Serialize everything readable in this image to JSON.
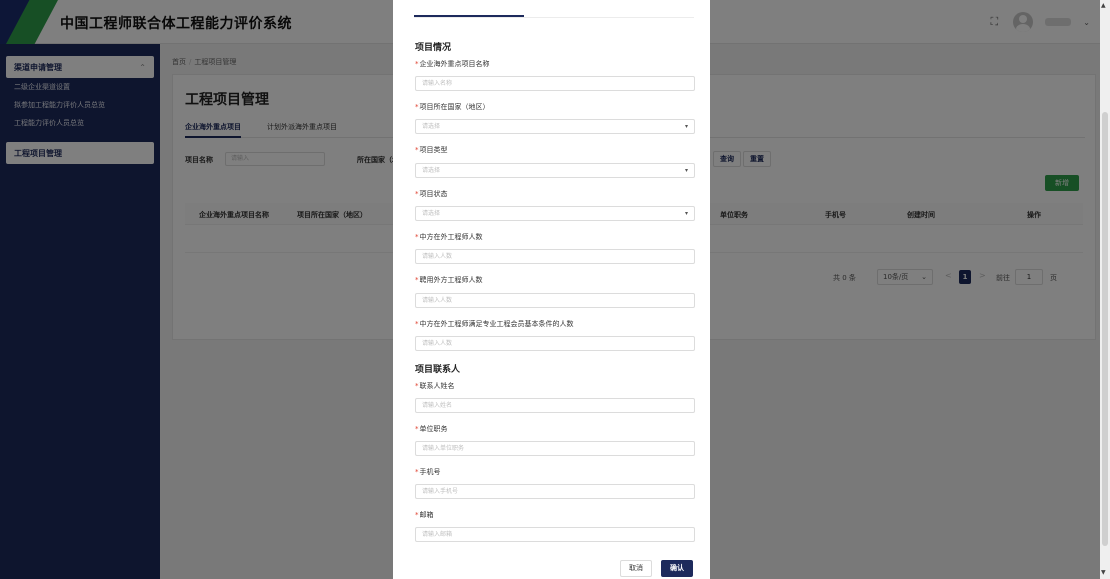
{
  "app": {
    "title": "中国工程师联合体工程能力评价系统"
  },
  "topbar": {
    "fullscreen_icon": "fullscreen-icon",
    "avatar_icon": "user-avatar-icon"
  },
  "sidebar": {
    "group1": {
      "label": "渠道申请管理",
      "chevron": "⌃"
    },
    "group1_items": [
      {
        "label": "二级企业渠道设置"
      },
      {
        "label": "拟参加工程能力评价人员总览"
      },
      {
        "label": "工程能力评价人员总览"
      }
    ],
    "group2": {
      "label": "工程项目管理"
    }
  },
  "main": {
    "breadcrumb": {
      "home": "首页",
      "sep": "/",
      "current": "工程项目管理"
    },
    "page_title": "工程项目管理",
    "tabs": [
      {
        "label": "企业海外重点项目",
        "active": true
      },
      {
        "label": "计划外派海外重点项目",
        "active": false
      }
    ],
    "filters": {
      "name_label": "项目名称",
      "name_placeholder": "请输入",
      "country_label": "所在国家（地"
    },
    "buttons": {
      "query": "查询",
      "reset": "重置",
      "add": "新增"
    },
    "table": {
      "columns": [
        "企业海外重点项目名称",
        "项目所在国家（地区）",
        "单位职务",
        "手机号",
        "创建时间",
        "操作"
      ]
    },
    "pagination": {
      "total": "共 0 条",
      "page_size": "10条/页",
      "prev": "<",
      "current_page": "1",
      "next": ">",
      "goto_label": "前往",
      "goto_value": "1",
      "page_unit": "页"
    }
  },
  "dialog": {
    "section1_title": "项目情况",
    "fields": [
      {
        "label": "企业海外重点项目名称",
        "placeholder": "请输入名称",
        "type": "input"
      },
      {
        "label": "项目所在国家（地区）",
        "placeholder": "请选择",
        "type": "select"
      },
      {
        "label": "项目类型",
        "placeholder": "请选择",
        "type": "select"
      },
      {
        "label": "项目状态",
        "placeholder": "请选择",
        "type": "select"
      },
      {
        "label": "中方在外工程师人数",
        "placeholder": "请输入人数",
        "type": "input"
      },
      {
        "label": "聘用外方工程师人数",
        "placeholder": "请输入人数",
        "type": "input"
      },
      {
        "label": "中方在外工程师满足专业工程会员基本条件的人数",
        "placeholder": "请输入人数",
        "type": "input"
      }
    ],
    "section2_title": "项目联系人",
    "contact_fields": [
      {
        "label": "联系人姓名",
        "placeholder": "请输入姓名"
      },
      {
        "label": "单位职务",
        "placeholder": "请输入单位职务"
      },
      {
        "label": "手机号",
        "placeholder": "请输入手机号"
      },
      {
        "label": "邮箱",
        "placeholder": "请输入邮箱"
      }
    ],
    "buttons": {
      "cancel": "取消",
      "confirm": "确认"
    },
    "required_mark": "*",
    "select_caret": "▾"
  },
  "colors": {
    "primary": "#1d2a5c",
    "accent_green": "#2f9e4a",
    "required": "#e0402e"
  }
}
